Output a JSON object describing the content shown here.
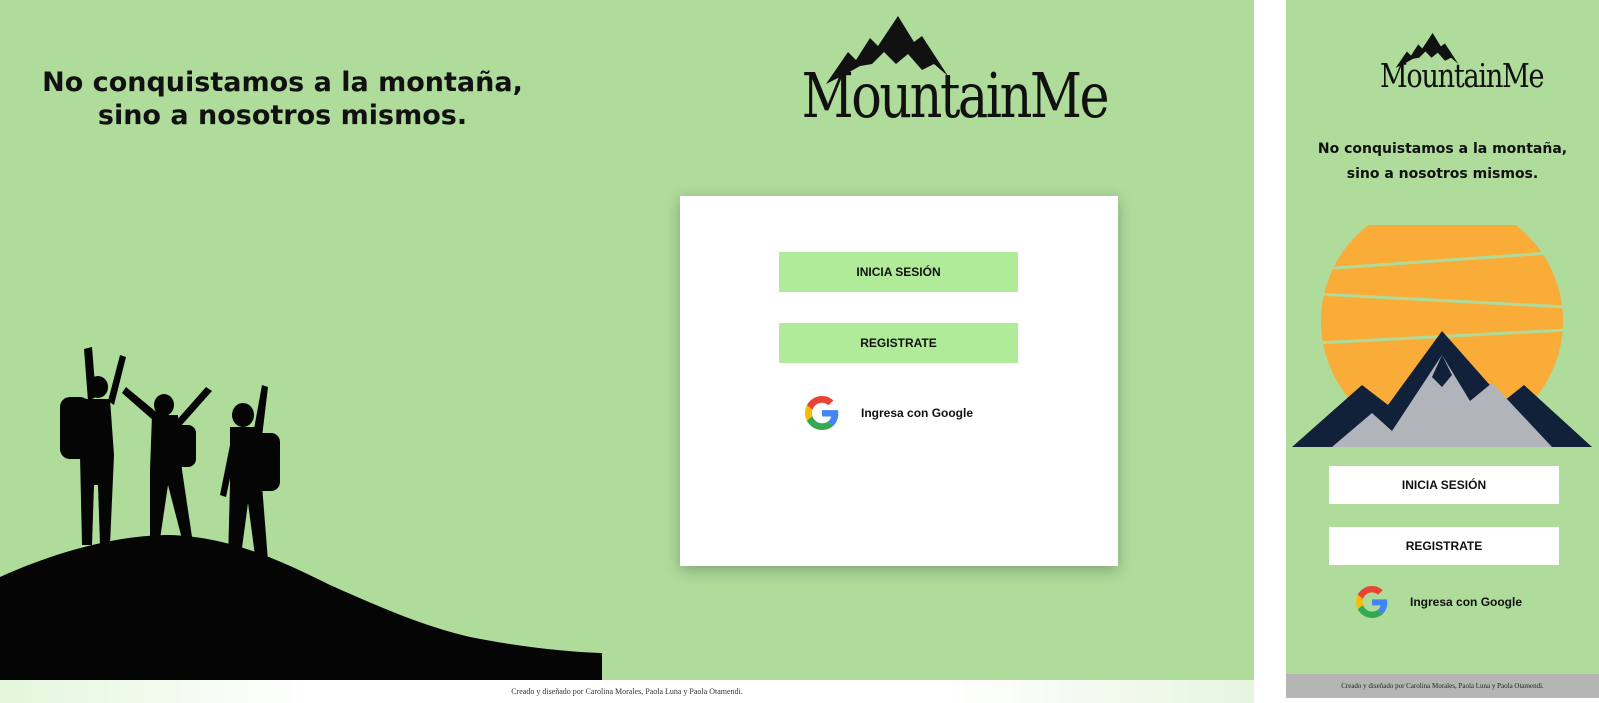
{
  "brand": {
    "name": "MountainMe",
    "logo_icon": "mountain-peaks-icon"
  },
  "slogan": {
    "line1": "No conquistamos a la montaña,",
    "line2": "sino a nosotros mismos."
  },
  "auth": {
    "login_label": "INICIA SESIÓN",
    "register_label": "REGISTRATE",
    "google_label": "Ingresa con Google",
    "google_icon": "google-g-icon"
  },
  "footer": {
    "credits": "Creado y diseñado por Carolina Morales, Paola Luna y Paola Otamendi."
  },
  "images": {
    "desktop_illustration": "hikers-silhouette-on-hill",
    "mobile_illustration": "sun-behind-mountains"
  },
  "colors": {
    "page_background": "#afdb9b",
    "button_green": "#b0eb9a",
    "card_white": "#ffffff",
    "sun_orange": "#f9ac38",
    "mountain_navy": "#12213a",
    "mountain_gray": "#b1b5bb",
    "mobile_footer_gray": "#b5b5b5"
  }
}
